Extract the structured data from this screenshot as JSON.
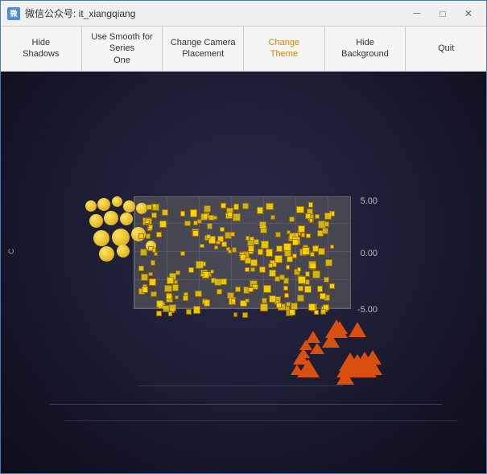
{
  "window": {
    "title": "微信公众号: it_xiangqiang",
    "icon_label": "微"
  },
  "window_controls": {
    "minimize": "－",
    "maximize": "□",
    "close": "✕"
  },
  "toolbar": {
    "buttons": [
      {
        "id": "hide-shadows",
        "label": "Hide\nShadows",
        "active": false
      },
      {
        "id": "smooth-series",
        "label": "Use Smooth for Series\nOne",
        "active": false
      },
      {
        "id": "camera-placement",
        "label": "Change Camera\nPlacement",
        "active": false
      },
      {
        "id": "change-theme",
        "label": "Change\nTheme",
        "active": true
      },
      {
        "id": "hide-background",
        "label": "Hide\nBackground",
        "active": false
      },
      {
        "id": "quit",
        "label": "Quit",
        "active": false
      }
    ]
  },
  "chart": {
    "axis_labels": {
      "y_top": "5.00",
      "y_mid": "0.00",
      "y_bot": "-5.00"
    },
    "side_label": "C"
  }
}
